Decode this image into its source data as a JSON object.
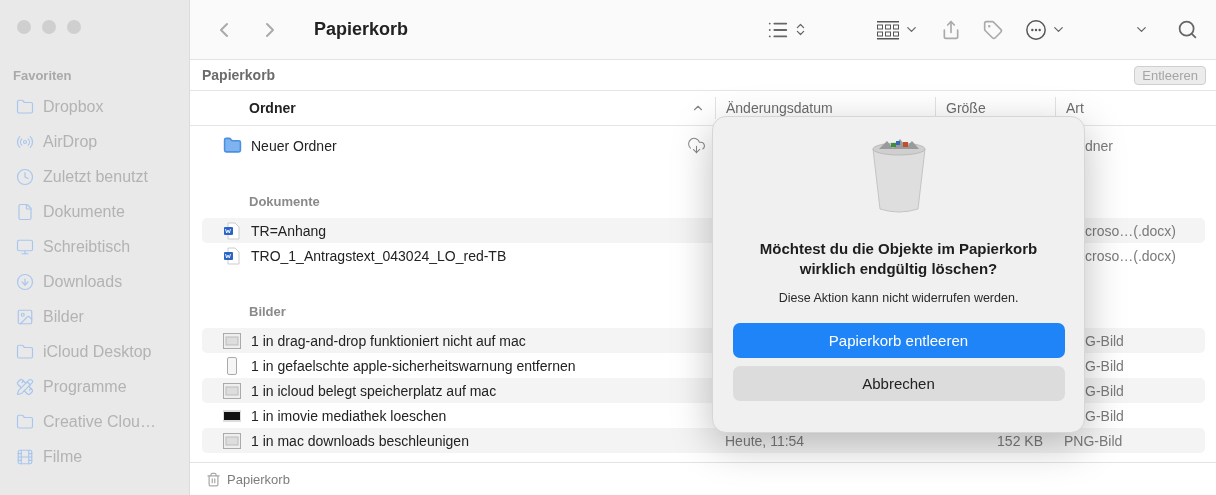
{
  "sidebar": {
    "heading": "Favoriten",
    "items": [
      {
        "label": "Dropbox"
      },
      {
        "label": "AirDrop"
      },
      {
        "label": "Zuletzt benutzt"
      },
      {
        "label": "Dokumente"
      },
      {
        "label": "Schreibtisch"
      },
      {
        "label": "Downloads"
      },
      {
        "label": "Bilder"
      },
      {
        "label": "iCloud Desktop"
      },
      {
        "label": "Programme"
      },
      {
        "label": "Creative Clou…"
      },
      {
        "label": "Filme"
      }
    ]
  },
  "toolbar": {
    "title": "Papierkorb"
  },
  "path_bar": {
    "title": "Papierkorb",
    "button": "Entleeren"
  },
  "columns": [
    {
      "label": "Ordner",
      "sorted": true
    },
    {
      "label": "Änderungsdatum",
      "sorted": false
    },
    {
      "label": "Größe",
      "sorted": false
    },
    {
      "label": "Art",
      "sorted": false
    }
  ],
  "groups": [
    {
      "rows": [
        {
          "kind": "folder",
          "name": "Neuer Ordner",
          "cloud": true,
          "covered": true,
          "type": "dner"
        }
      ]
    },
    {
      "heading": "Dokumente",
      "rows": [
        {
          "kind": "word",
          "name": "TR=Anhang",
          "covered": true,
          "type": "croso…(.docx)"
        },
        {
          "kind": "word",
          "name": "TRO_1_Antragstext_043024_LO_red-TB",
          "covered": true,
          "type": "croso…(.docx)"
        }
      ]
    },
    {
      "heading": "Bilder",
      "rows": [
        {
          "kind": "image",
          "name": "1 in drag-and-drop funktioniert nicht auf mac",
          "covered": true,
          "type": "G-Bild"
        },
        {
          "kind": "phone",
          "name": "1 in gefaelschte apple-sicherheitswarnung entfernen",
          "covered": true,
          "type": "G-Bild"
        },
        {
          "kind": "image",
          "name": "1 in icloud belegt speicherplatz auf mac",
          "covered": true,
          "type": "G-Bild"
        },
        {
          "kind": "dark",
          "name": "1 in imovie mediathek loeschen",
          "covered": true,
          "type": "G-Bild"
        },
        {
          "kind": "image",
          "name": "1 in mac downloads beschleunigen",
          "covered": false,
          "date": "Heute, 11:54",
          "size": "152 KB",
          "type": "PNG-Bild"
        }
      ]
    }
  ],
  "status_bar": {
    "label": "Papierkorb"
  },
  "dialog": {
    "title": "Möchtest du die Objekte im Papierkorb wirklich endgültig löschen?",
    "message": "Diese Aktion kann nicht widerrufen werden.",
    "buttons": [
      {
        "label": "Papierkorb entleeren",
        "primary": true
      },
      {
        "label": "Abbrechen",
        "primary": false
      }
    ]
  }
}
